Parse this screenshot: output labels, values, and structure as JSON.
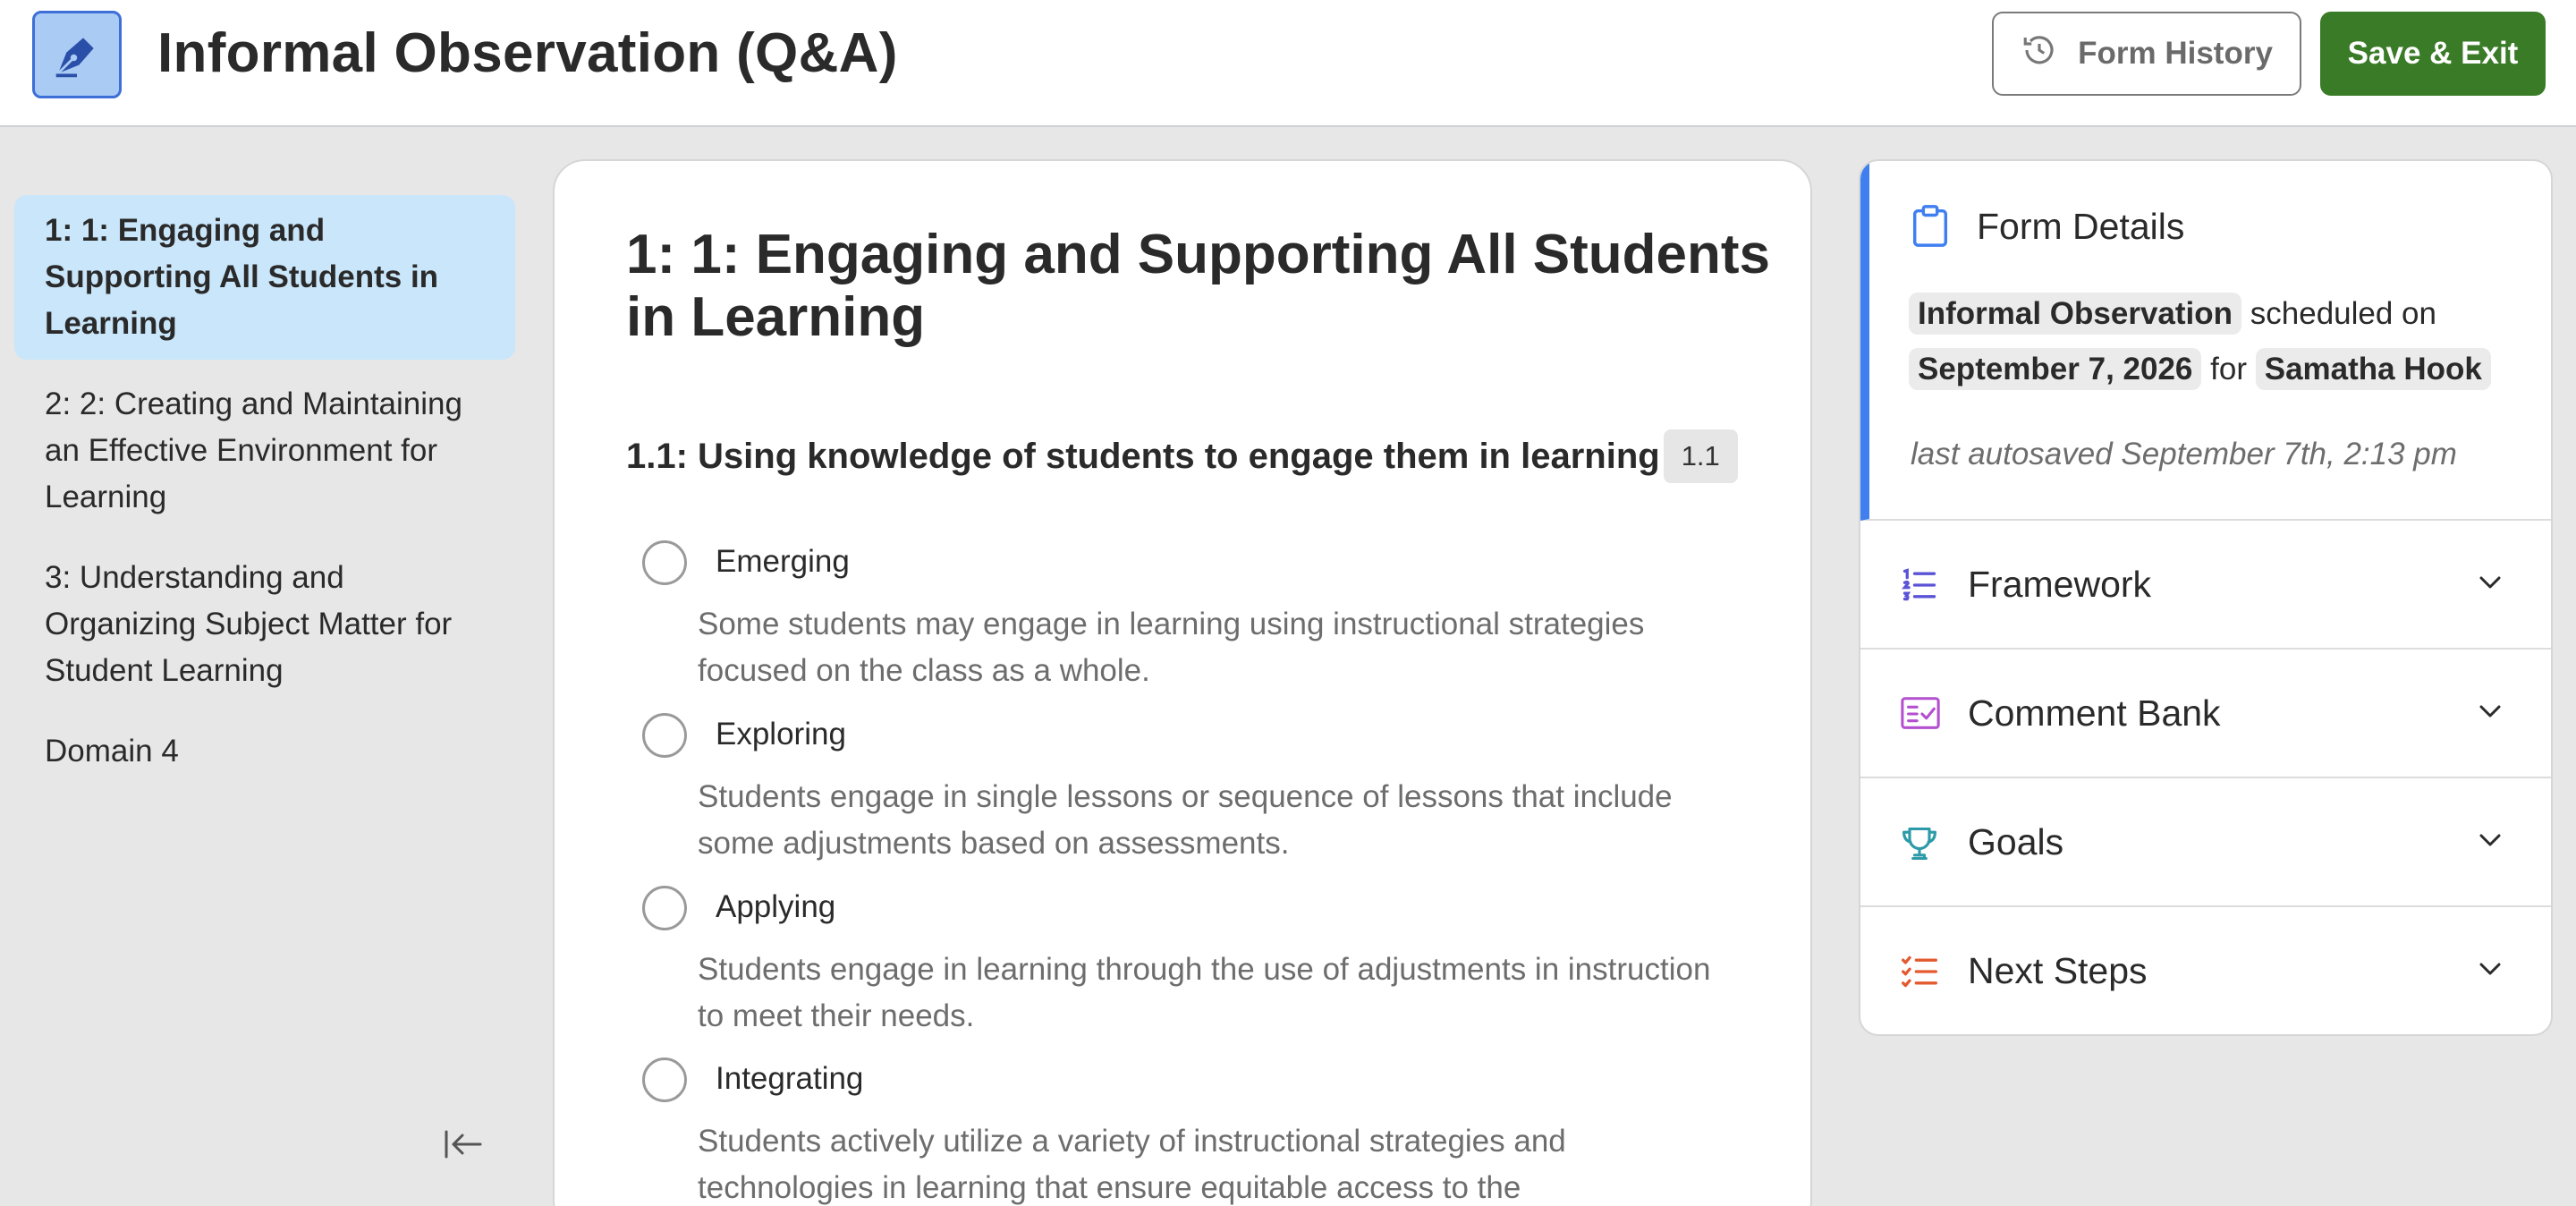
{
  "header": {
    "app_icon": "pen-nib-icon",
    "title": "Informal Observation (Q&A)",
    "history_button": "Form History",
    "history_icon": "history-clock-icon",
    "save_button": "Save & Exit"
  },
  "sidebar": {
    "items": [
      {
        "label": "1: 1: Engaging and Supporting All Students in Learning",
        "active": true
      },
      {
        "label": "2: 2: Creating and Maintaining an Effective Environment for Learning",
        "active": false
      },
      {
        "label": "3: Understanding and Organizing Subject Matter for Student Learning",
        "active": false
      },
      {
        "label": "Domain 4",
        "active": false
      }
    ],
    "collapse_icon": "collapse-left-icon"
  },
  "main": {
    "section_title": "1: 1: Engaging and Supporting All Students in Learning",
    "question": {
      "title": "1.1: Using knowledge of students to engage them in learning",
      "badge": "1.1"
    },
    "options": [
      {
        "label": "Emerging",
        "description": "Some students may engage in learning using instructional strategies focused on the class as a whole."
      },
      {
        "label": "Exploring",
        "description": "Students engage in single lessons or sequence of lessons that include some adjustments based on assessments."
      },
      {
        "label": "Applying",
        "description": "Students engage in learning through the use of adjustments in instruction to meet their needs."
      },
      {
        "label": "Integrating",
        "description": "Students actively utilize a variety of instructional strategies and technologies in learning that ensure equitable access to the"
      }
    ]
  },
  "details": {
    "title": "Form Details",
    "icon": "clipboard-icon",
    "form_type": "Informal Observation",
    "scheduled_text": "scheduled on",
    "date": "September 7, 2026",
    "for_text": "for",
    "person": "Samatha Hook",
    "autosave": "last autosaved September 7th, 2:13 pm"
  },
  "accordion": [
    {
      "label": "Framework",
      "icon": "numbered-list-icon",
      "color": "#5b53d6"
    },
    {
      "label": "Comment Bank",
      "icon": "comment-list-icon",
      "color": "#b44fd0"
    },
    {
      "label": "Goals",
      "icon": "trophy-icon",
      "color": "#2c9aa8"
    },
    {
      "label": "Next Steps",
      "icon": "checklist-icon",
      "color": "#e4592f"
    }
  ],
  "colors": {
    "accent_blue": "#3f7ff0",
    "save_green": "#3a7b27",
    "sidebar_active": "#c9e6fa"
  }
}
